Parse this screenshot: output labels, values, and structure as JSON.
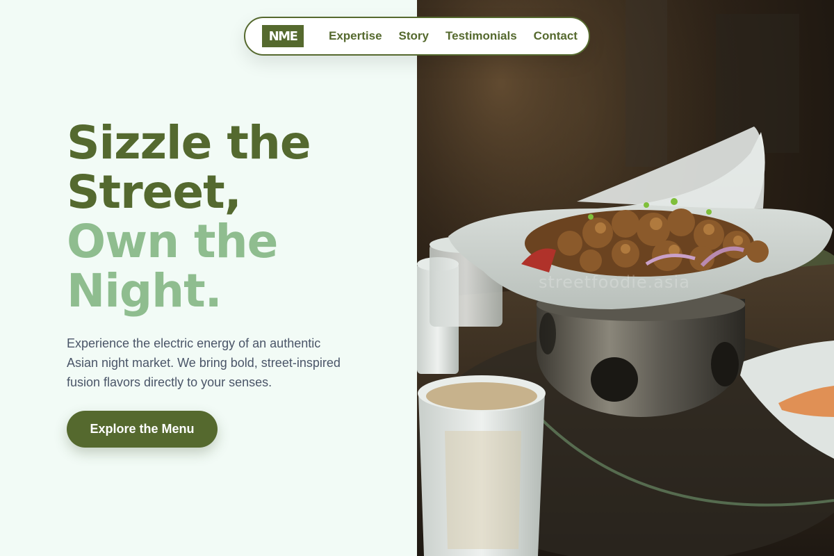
{
  "nav": {
    "logo": "NME",
    "links": [
      "Expertise",
      "Story",
      "Testimonials",
      "Contact"
    ]
  },
  "hero": {
    "headline_line1": "Sizzle the",
    "headline_line2": "Street,",
    "headline_line3": "Own the",
    "headline_line4": "Night.",
    "description": "Experience the electric energy of an authentic Asian night market. We bring bold, street-inspired fusion flavors directly to your senses.",
    "cta_label": "Explore the Menu"
  },
  "photo": {
    "watermark": "streetfoodie.asia",
    "alt": "Sizzling stir-fried dish served on a heated pot"
  },
  "colors": {
    "brand_dark": "#55692e",
    "brand_light": "#8fbd8f",
    "background": "#f2fbf6",
    "body_text": "#4a5568"
  }
}
